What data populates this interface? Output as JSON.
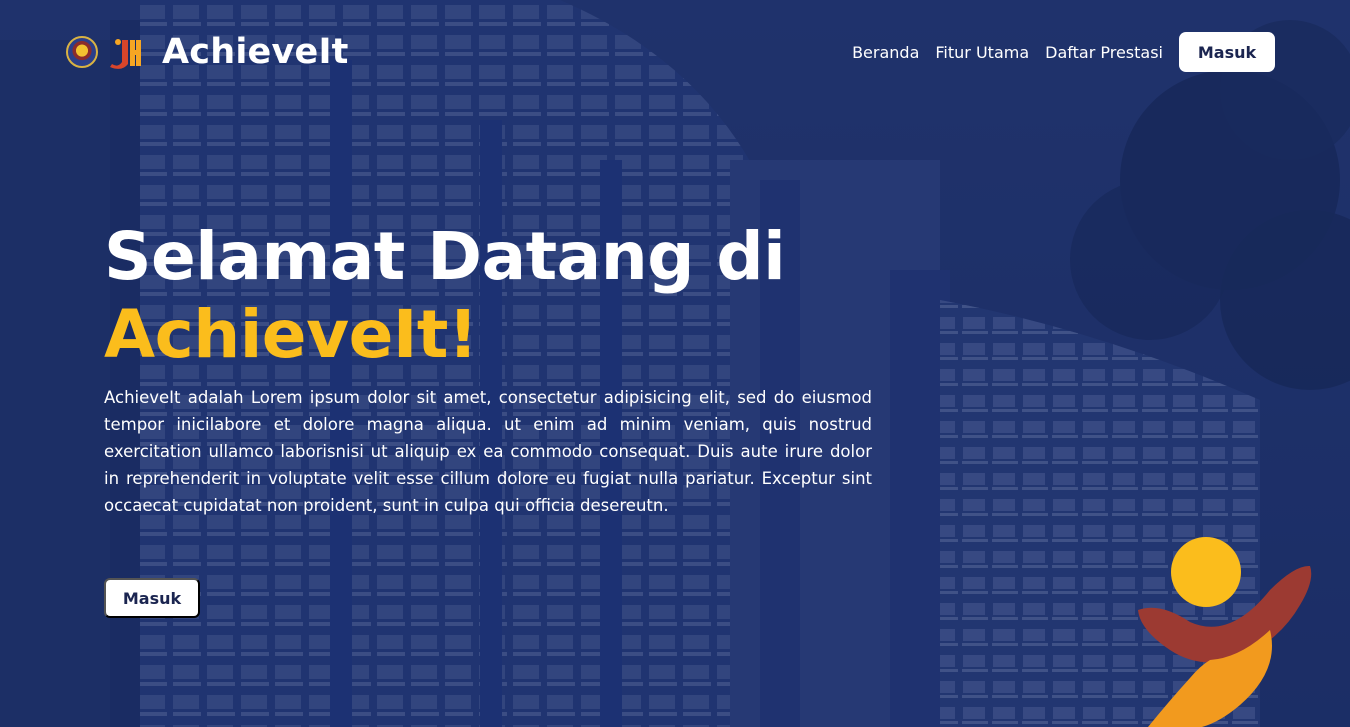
{
  "brand": {
    "name": "AchieveIt",
    "logo_primary": "polinema-seal-icon",
    "logo_secondary": "ji-logo-icon"
  },
  "nav": {
    "links": [
      "Beranda",
      "Fitur Utama",
      "Daftar Prestasi"
    ],
    "login_label": "Masuk"
  },
  "hero": {
    "title_line1": "Selamat Datang di",
    "title_accent": "AchieveIt!",
    "description": "AchieveIt adalah Lorem ipsum dolor sit amet, consectetur adipisicing elit, sed do eiusmod tempor inicilabore et dolore magna aliqua. ut enim ad minim veniam, quis nostrud exercitation ullamco laborisnisi ut aliquip ex ea commodo consequat. Duis aute irure dolor in reprehenderit in voluptate velit esse cillum dolore eu fugiat nulla pariatur. Exceptur sint occaecat cupidatat non proident, sunt in culpa qui officia desereutn.",
    "cta_label": "Masuk"
  },
  "colors": {
    "overlay": "#16285f",
    "accent": "#fbbd1c",
    "button_text": "#1b2550",
    "mascot_red": "#9c3a32",
    "mascot_orange": "#f29a1e"
  }
}
